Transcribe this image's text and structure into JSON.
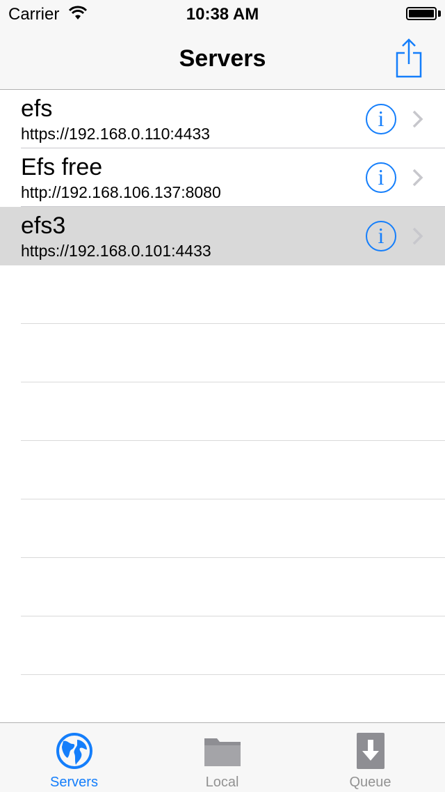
{
  "status_bar": {
    "carrier": "Carrier",
    "time": "10:38 AM"
  },
  "nav": {
    "title": "Servers",
    "share_icon": "share-icon"
  },
  "servers": [
    {
      "name": "efs",
      "url": "https://192.168.0.110:4433",
      "selected": false
    },
    {
      "name": "Efs free",
      "url": "http://192.168.106.137:8080",
      "selected": false
    },
    {
      "name": "efs3",
      "url": "https://192.168.0.101:4433",
      "selected": true
    }
  ],
  "info_glyph": "i",
  "tabs": [
    {
      "label": "Servers",
      "icon": "globe-icon",
      "active": true
    },
    {
      "label": "Local",
      "icon": "folder-icon",
      "active": false
    },
    {
      "label": "Queue",
      "icon": "download-icon",
      "active": false
    }
  ],
  "colors": {
    "accent": "#147efb",
    "inactive": "#929292",
    "selected_row": "#d9d9d9"
  }
}
